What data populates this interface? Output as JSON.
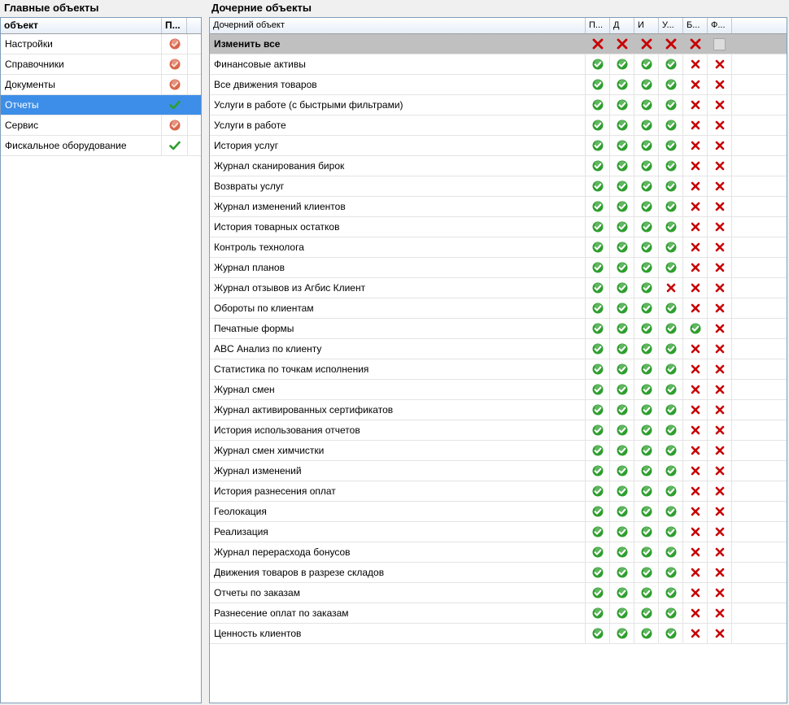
{
  "main_objects_title": "Главные объекты",
  "child_objects_title": "Дочерние объекты",
  "left_table": {
    "headers": [
      "объект",
      "П..."
    ],
    "rows": [
      {
        "name": "Настройки",
        "status": "partial"
      },
      {
        "name": "Справочники",
        "status": "partial"
      },
      {
        "name": "Документы",
        "status": "partial"
      },
      {
        "name": "Отчеты",
        "status": "check",
        "selected": true
      },
      {
        "name": "Сервис",
        "status": "partial"
      },
      {
        "name": "Фискальное оборудование",
        "status": "check"
      }
    ]
  },
  "right_table": {
    "headers": [
      "Дочерний объект",
      "П...",
      "Д",
      "И",
      "У...",
      "Б...",
      "Ф..."
    ],
    "change_all": {
      "name": "Изменить все",
      "perms": [
        "x",
        "x",
        "x",
        "x",
        "x",
        "empty"
      ]
    },
    "rows": [
      {
        "name": "Финансовые активы",
        "perms": [
          "y",
          "y",
          "y",
          "y",
          "n",
          "n"
        ]
      },
      {
        "name": "Все движения товаров",
        "perms": [
          "y",
          "y",
          "y",
          "y",
          "n",
          "n"
        ]
      },
      {
        "name": "Услуги в работе (с быстрыми фильтрами)",
        "perms": [
          "y",
          "y",
          "y",
          "y",
          "n",
          "n"
        ]
      },
      {
        "name": "Услуги в работе",
        "perms": [
          "y",
          "y",
          "y",
          "y",
          "n",
          "n"
        ]
      },
      {
        "name": "История услуг",
        "perms": [
          "y",
          "y",
          "y",
          "y",
          "n",
          "n"
        ]
      },
      {
        "name": "Журнал сканирования бирок",
        "perms": [
          "y",
          "y",
          "y",
          "y",
          "n",
          "n"
        ]
      },
      {
        "name": "Возвраты услуг",
        "perms": [
          "y",
          "y",
          "y",
          "y",
          "n",
          "n"
        ]
      },
      {
        "name": "Журнал изменений клиентов",
        "perms": [
          "y",
          "y",
          "y",
          "y",
          "n",
          "n"
        ]
      },
      {
        "name": "История товарных остатков",
        "perms": [
          "y",
          "y",
          "y",
          "y",
          "n",
          "n"
        ]
      },
      {
        "name": "Контроль технолога",
        "perms": [
          "y",
          "y",
          "y",
          "y",
          "n",
          "n"
        ]
      },
      {
        "name": "Журнал планов",
        "perms": [
          "y",
          "y",
          "y",
          "y",
          "n",
          "n"
        ]
      },
      {
        "name": "Журнал отзывов из Агбис Клиент",
        "perms": [
          "y",
          "y",
          "y",
          "n",
          "n",
          "n"
        ]
      },
      {
        "name": "Обороты по клиентам",
        "perms": [
          "y",
          "y",
          "y",
          "y",
          "n",
          "n"
        ]
      },
      {
        "name": "Печатные формы",
        "perms": [
          "y",
          "y",
          "y",
          "y",
          "y",
          "n"
        ]
      },
      {
        "name": "ABC Анализ по клиенту",
        "perms": [
          "y",
          "y",
          "y",
          "y",
          "n",
          "n"
        ]
      },
      {
        "name": "Статистика по точкам исполнения",
        "perms": [
          "y",
          "y",
          "y",
          "y",
          "n",
          "n"
        ]
      },
      {
        "name": "Журнал смен",
        "perms": [
          "y",
          "y",
          "y",
          "y",
          "n",
          "n"
        ]
      },
      {
        "name": "Журнал активированных сертификатов",
        "perms": [
          "y",
          "y",
          "y",
          "y",
          "n",
          "n"
        ]
      },
      {
        "name": "История использования отчетов",
        "perms": [
          "y",
          "y",
          "y",
          "y",
          "n",
          "n"
        ]
      },
      {
        "name": "Журнал смен химчистки",
        "perms": [
          "y",
          "y",
          "y",
          "y",
          "n",
          "n"
        ]
      },
      {
        "name": "Журнал изменений",
        "perms": [
          "y",
          "y",
          "y",
          "y",
          "n",
          "n"
        ]
      },
      {
        "name": "История разнесения оплат",
        "perms": [
          "y",
          "y",
          "y",
          "y",
          "n",
          "n"
        ]
      },
      {
        "name": "Геолокация",
        "perms": [
          "y",
          "y",
          "y",
          "y",
          "n",
          "n"
        ]
      },
      {
        "name": "Реализация",
        "perms": [
          "y",
          "y",
          "y",
          "y",
          "n",
          "n"
        ]
      },
      {
        "name": "Журнал перерасхода бонусов",
        "perms": [
          "y",
          "y",
          "y",
          "y",
          "n",
          "n"
        ]
      },
      {
        "name": "Движения товаров в разрезе складов",
        "perms": [
          "y",
          "y",
          "y",
          "y",
          "n",
          "n"
        ]
      },
      {
        "name": "Отчеты по заказам",
        "perms": [
          "y",
          "y",
          "y",
          "y",
          "n",
          "n"
        ]
      },
      {
        "name": "Разнесение оплат по заказам",
        "perms": [
          "y",
          "y",
          "y",
          "y",
          "n",
          "n"
        ]
      },
      {
        "name": "Ценность клиентов",
        "perms": [
          "y",
          "y",
          "y",
          "y",
          "n",
          "n"
        ]
      }
    ]
  },
  "colors": {
    "selected_row": "#3d8ee8",
    "allowed": "#2e9e2e",
    "denied": "#c80000",
    "partial": "#d9664a"
  }
}
